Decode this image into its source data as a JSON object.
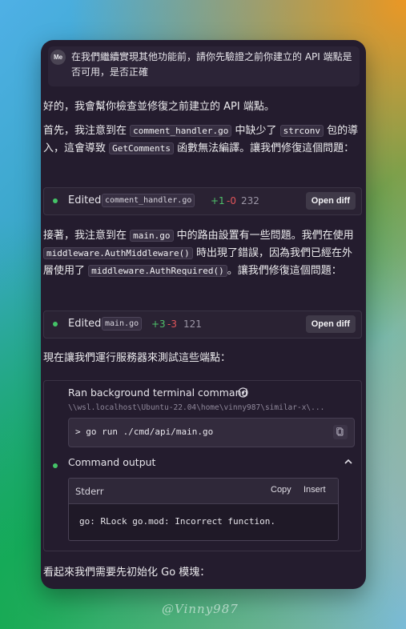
{
  "user_message": {
    "avatar": "Me",
    "text": "在我們繼續實現其他功能前，請你先驗證之前你建立的 API 端點是否可用，是否正確"
  },
  "reply_intro": "好的，我會幫你檢查並修復之前建立的 API 端點。",
  "para1": {
    "t1": "首先，我注意到在 ",
    "code1": "comment_handler.go",
    "t2": " 中缺少了 ",
    "code2": "strconv",
    "t3": " 包的導入，這會導致 ",
    "code3": "GetComments",
    "t4": " 函數無法編譯。讓我們修復這個問題："
  },
  "edit1": {
    "label": "Edited",
    "file": "comment_handler.go",
    "added": "+1",
    "removed": "-0",
    "count": "232",
    "button": "Open diff"
  },
  "para2": {
    "t1": "接著，我注意到在 ",
    "code1": "main.go",
    "t2": " 中的路由設置有一些問題。我們在使用 ",
    "code2": "middleware.AuthMiddleware()",
    "t3": " 時出現了錯誤，因為我們已經在外層使用了 ",
    "code3": "middleware.AuthRequired()",
    "t4": "。讓我們修復這個問題："
  },
  "edit2": {
    "label": "Edited",
    "file": "main.go",
    "added": "+3",
    "removed": "-3",
    "count": "121",
    "button": "Open diff"
  },
  "para3": "現在讓我們運行服務器來測試這些端點：",
  "terminal": {
    "title": "Ran background terminal command",
    "path": "\\\\wsl.localhost\\Ubuntu-22.04\\home\\vinny987\\similar-x\\...",
    "command": "> go run ./cmd/api/main.go",
    "output_label": "Command output",
    "stream": "Stderr",
    "copy": "Copy",
    "insert": "Insert",
    "output": "go: RLock go.mod: Incorrect function."
  },
  "para4": "看起來我們需要先初始化 Go 模塊：",
  "watermark": "@Vinny987",
  "colors": {
    "accent_green": "#44c367",
    "removed_red": "#e2555a",
    "panel": "#241c2e"
  }
}
